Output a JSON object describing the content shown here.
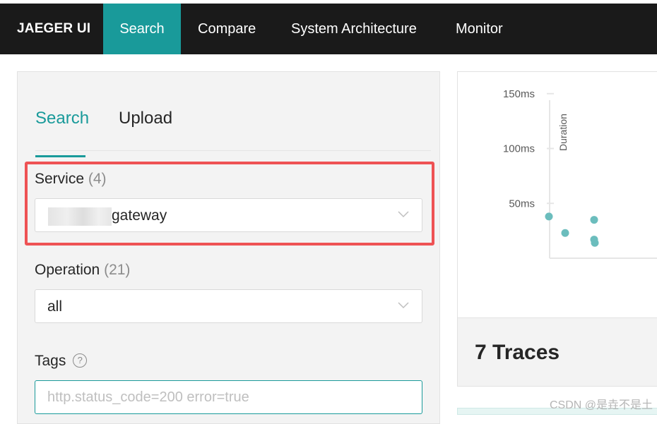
{
  "nav": {
    "brand": "JAEGER UI",
    "items": [
      {
        "label": "Search",
        "active": true
      },
      {
        "label": "Compare",
        "active": false
      },
      {
        "label": "System Architecture",
        "active": false
      },
      {
        "label": "Monitor",
        "active": false
      }
    ]
  },
  "search_panel": {
    "tabs": [
      {
        "label": "Search",
        "active": true
      },
      {
        "label": "Upload",
        "active": false
      }
    ],
    "service": {
      "label": "Service",
      "count": "(4)",
      "value": "gateway"
    },
    "operation": {
      "label": "Operation",
      "count": "(21)",
      "value": "all"
    },
    "tags": {
      "label": "Tags",
      "help": "?",
      "placeholder": "http.status_code=200 error=true"
    }
  },
  "chart_data": {
    "type": "scatter",
    "ylabel": "Duration",
    "y_ticks": [
      "150ms",
      "100ms",
      "50ms"
    ],
    "points": [
      {
        "y_ms": 38
      },
      {
        "y_ms": 23
      },
      {
        "y_ms": 35
      },
      {
        "y_ms": 17
      },
      {
        "y_ms": 14
      }
    ],
    "point_color": "#6bbdbd"
  },
  "results": {
    "title": "7 Traces"
  },
  "watermark": "CSDN @是垚不是土",
  "colors": {
    "accent": "#199a9a",
    "highlight": "#ee5254",
    "nav_bg": "#1a1a1a"
  }
}
